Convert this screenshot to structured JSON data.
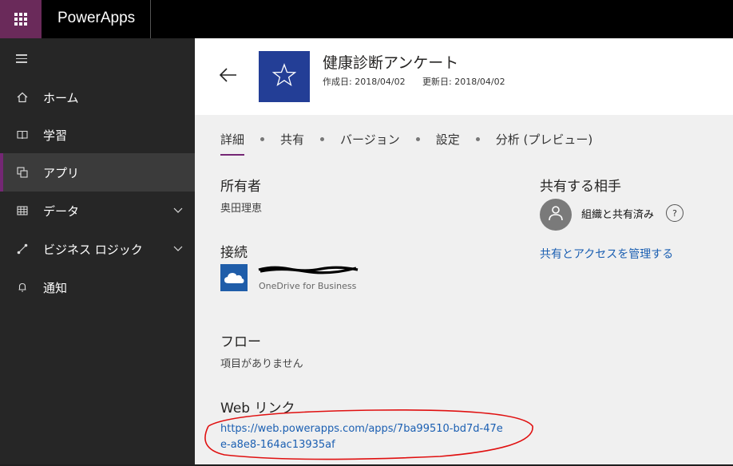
{
  "topbar": {
    "app_name": "PowerApps",
    "waffle_icon": "waffle-icon"
  },
  "sidebar": {
    "items": [
      {
        "label": "ホーム",
        "icon": "home-icon"
      },
      {
        "label": "学習",
        "icon": "book-icon"
      },
      {
        "label": "アプリ",
        "icon": "apps-icon",
        "active": true
      },
      {
        "label": "データ",
        "icon": "table-icon",
        "expandable": true
      },
      {
        "label": "ビジネス ロジック",
        "icon": "flow-icon",
        "expandable": true
      },
      {
        "label": "通知",
        "icon": "bell-icon"
      }
    ]
  },
  "header": {
    "app_name": "健康診断アンケート",
    "created_label": "作成日: 2018/04/02",
    "updated_label": "更新日: 2018/04/02",
    "tile_color": "#233e96"
  },
  "tabs": [
    "詳細",
    "共有",
    "バージョン",
    "設定",
    "分析 (プレビュー)"
  ],
  "details": {
    "owner_title": "所有者",
    "owner_name": "奥田理恵",
    "connection_title": "接続",
    "connection_type": "OneDrive for Business",
    "flow_title": "フロー",
    "flow_empty": "項目がありません",
    "web_link_title": "Web リンク",
    "web_link_url": "https://web.powerapps.com/apps/7ba99510-bd7d-47ee-a8e8-164ac13935af"
  },
  "sharing": {
    "title": "共有する相手",
    "status": "組織と共有済み",
    "help": "?",
    "manage_link": "共有とアクセスを管理する"
  },
  "colors": {
    "accent": "#742774",
    "link": "#1b5fb2",
    "annotation": "#e01010"
  }
}
